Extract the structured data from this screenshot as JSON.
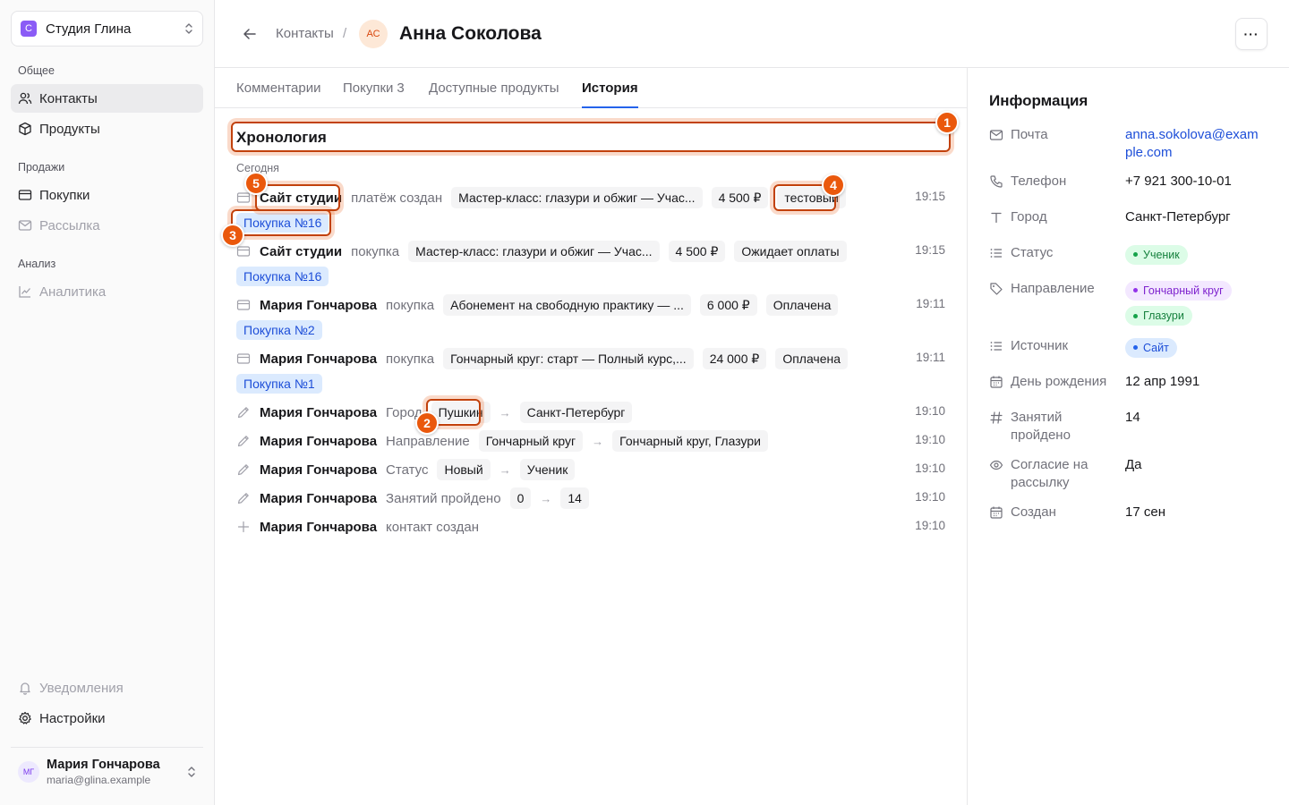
{
  "sidebar": {
    "workspace": {
      "initial": "С",
      "name": "Студия Глина"
    },
    "sections": [
      {
        "label": "Общее"
      },
      {
        "label": "Продажи"
      },
      {
        "label": "Анализ"
      }
    ],
    "items": [
      {
        "label": "Контакты",
        "icon": "users-icon",
        "active": true
      },
      {
        "label": "Продукты",
        "icon": "box-icon"
      },
      {
        "label": "Покупки",
        "icon": "credit-card-icon"
      },
      {
        "label": "Рассылка",
        "icon": "mail-icon"
      },
      {
        "label": "Аналитика",
        "icon": "chart-icon"
      }
    ],
    "bottom": [
      {
        "label": "Уведомления",
        "icon": "bell-icon"
      },
      {
        "label": "Настройки",
        "icon": "gear-icon"
      }
    ],
    "user": {
      "initials": "МГ",
      "name": "Мария Гончарова",
      "email": "maria@glina.example"
    }
  },
  "header": {
    "breadcrumb": "Контакты",
    "separator": "/",
    "avatar_initials": "АС",
    "title": "Анна Соколова",
    "more": "···"
  },
  "tabs": [
    {
      "label": "Комментарии"
    },
    {
      "label": "Покупки",
      "count": "3"
    },
    {
      "label": "Доступные продукты"
    },
    {
      "label": "История",
      "active": true
    }
  ],
  "timeline": {
    "title": "Хронология",
    "day": "Сегодня",
    "events": [
      {
        "icon": "credit-card-icon",
        "actor": "Сайт студии",
        "action": "платёж создан",
        "chips": [
          "Мастер-класс: глазури и обжиг — Учас...",
          "4 500 ₽",
          "тестовый"
        ],
        "time": "19:15",
        "ref": "Покупка №16"
      },
      {
        "icon": "credit-card-icon",
        "actor": "Сайт студии",
        "action": "покупка",
        "chips": [
          "Мастер-класс: глазури и обжиг — Учас...",
          "4 500 ₽",
          "Ожидает оплаты"
        ],
        "time": "19:15",
        "ref": "Покупка №16"
      },
      {
        "icon": "credit-card-icon",
        "actor": "Мария Гончарова",
        "action": "покупка",
        "chips": [
          "Абонемент на свободную практику — ...",
          "6 000 ₽",
          "Оплачена"
        ],
        "time": "19:11",
        "ref": "Покупка №2"
      },
      {
        "icon": "credit-card-icon",
        "actor": "Мария Гончарова",
        "action": "покупка",
        "chips": [
          "Гончарный круг: старт — Полный курс,...",
          "24 000 ₽",
          "Оплачена"
        ],
        "time": "19:11",
        "ref": "Покупка №1"
      },
      {
        "icon": "pencil-icon",
        "actor": "Мария Гончарова",
        "action": "Город",
        "from": "Пушкин",
        "to": "Санкт-Петербург",
        "time": "19:10"
      },
      {
        "icon": "pencil-icon",
        "actor": "Мария Гончарова",
        "action": "Направление",
        "from": "Гончарный круг",
        "to": "Гончарный круг, Глазури",
        "time": "19:10"
      },
      {
        "icon": "pencil-icon",
        "actor": "Мария Гончарова",
        "action": "Статус",
        "from": "Новый",
        "to": "Ученик",
        "time": "19:10"
      },
      {
        "icon": "pencil-icon",
        "actor": "Мария Гончарова",
        "action": "Занятий пройдено",
        "from": "0",
        "to": "14",
        "time": "19:10"
      },
      {
        "icon": "plus-icon",
        "actor": "Мария Гончарова",
        "action": "контакт создан",
        "time": "19:10"
      }
    ],
    "arrow": "→"
  },
  "info": {
    "title": "Информация",
    "rows": [
      {
        "icon": "mail-icon",
        "label": "Почта",
        "value": "anna.sokolova@example.com",
        "link": true
      },
      {
        "icon": "phone-icon",
        "label": "Телефон",
        "value": "+7 921 300-10-01"
      },
      {
        "icon": "text-icon",
        "label": "Город",
        "value": "Санкт-Петербург"
      },
      {
        "icon": "list-icon",
        "label": "Статус",
        "pills": [
          {
            "label": "Ученик",
            "color": "green"
          }
        ]
      },
      {
        "icon": "tag-icon",
        "label": "Направление",
        "pills": [
          {
            "label": "Гончарный круг",
            "color": "purple"
          },
          {
            "label": "Глазури",
            "color": "green"
          }
        ]
      },
      {
        "icon": "list-icon",
        "label": "Источник",
        "pills": [
          {
            "label": "Сайт",
            "color": "blue"
          }
        ]
      },
      {
        "icon": "calendar-icon",
        "label": "День рождения",
        "value": "12 апр 1991"
      },
      {
        "icon": "hash-icon",
        "label": "Занятий пройдено",
        "value": "14"
      },
      {
        "icon": "eye-icon",
        "label": "Согласие на рассылку",
        "value": "Да"
      },
      {
        "icon": "calendar-icon",
        "label": "Создан",
        "value": "17 сен"
      }
    ]
  },
  "annotations": [
    "1",
    "2",
    "3",
    "4",
    "5"
  ],
  "colors": {
    "accent": "#2563eb",
    "annotation": "#ea580c",
    "workspace": "#8b5cf6"
  }
}
